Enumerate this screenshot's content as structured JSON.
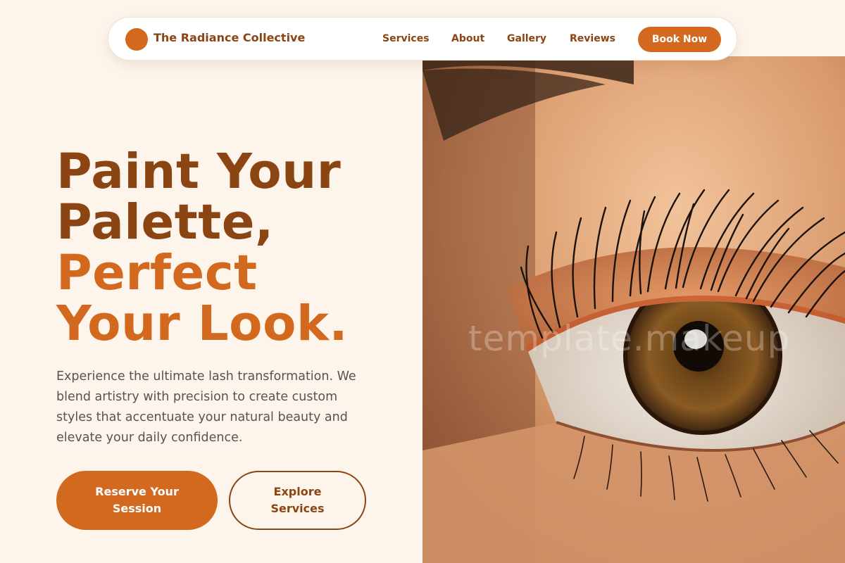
{
  "brand": {
    "name": "The Radiance Collective",
    "accent_color": "#d2691e",
    "dark_color": "#8b4513"
  },
  "nav": {
    "links": [
      {
        "label": "Services"
      },
      {
        "label": "About"
      },
      {
        "label": "Gallery"
      },
      {
        "label": "Reviews"
      }
    ],
    "cta_label": "Book Now"
  },
  "hero": {
    "headline_lines": [
      "Paint Your",
      "Palette,",
      "Perfect",
      "Your Look."
    ],
    "description": "Experience the ultimate lash transformation. We blend artistry with precision to create custom styles that accentuate your natural beauty and elevate your daily confidence.",
    "primary_cta": "Reserve Your Session",
    "secondary_cta": "Explore Services",
    "image": {
      "subject": "close-up-eye-with-lashes",
      "watermark": "template.makeup"
    }
  }
}
